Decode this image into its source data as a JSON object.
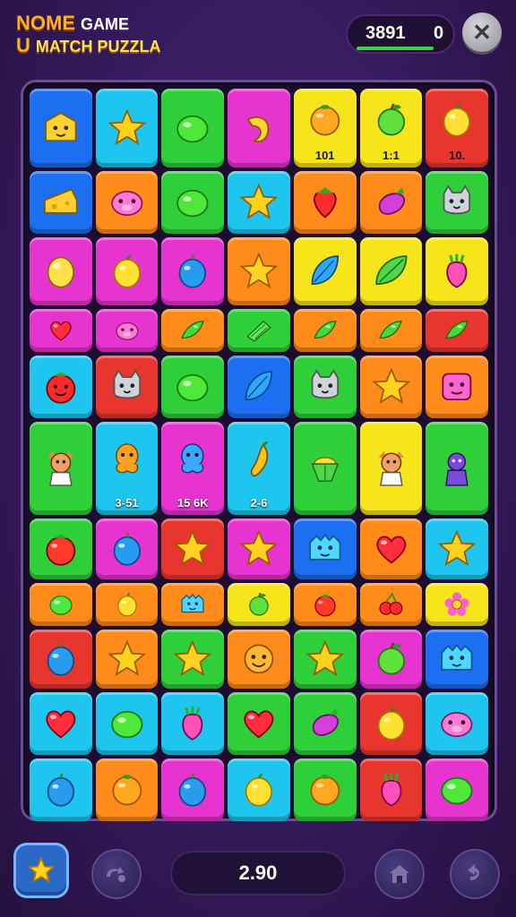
{
  "header": {
    "title_line1_a": "NOME",
    "title_line1_b": "GAME",
    "title_line2_a": "U",
    "title_line2_b": "MATCH PUZZLA",
    "score": "3891",
    "score_extra": "0",
    "close_label": "✕"
  },
  "colors": {
    "yellow": "#f7e51b",
    "cyan": "#1ec6ef",
    "green": "#2fcf3a",
    "magenta": "#e733cf",
    "red": "#e8352d",
    "orange": "#ff8b1a",
    "blue": "#1b6ff0"
  },
  "grid": {
    "columns": 7,
    "rows": [
      {
        "tiles": [
          {
            "color": "blue",
            "icon": "cheese-face",
            "label": ""
          },
          {
            "color": "cyan",
            "icon": "star",
            "label": ""
          },
          {
            "color": "green",
            "icon": "lime",
            "label": ""
          },
          {
            "color": "magenta",
            "icon": "banana",
            "label": ""
          },
          {
            "color": "yellow",
            "icon": "orange-fruit",
            "label": "101"
          },
          {
            "color": "yellow",
            "icon": "apple",
            "label": "1:1"
          },
          {
            "color": "red",
            "icon": "lemon",
            "label": "10."
          }
        ]
      },
      {
        "tiles": [
          {
            "color": "blue",
            "icon": "cheese",
            "label": ""
          },
          {
            "color": "orange",
            "icon": "pig-face",
            "label": ""
          },
          {
            "color": "green",
            "icon": "lime",
            "label": ""
          },
          {
            "color": "cyan",
            "icon": "star",
            "label": ""
          },
          {
            "color": "orange",
            "icon": "strawberry",
            "label": ""
          },
          {
            "color": "orange",
            "icon": "eggplant",
            "label": ""
          },
          {
            "color": "green",
            "icon": "cat-face",
            "label": ""
          }
        ]
      },
      {
        "tiles": [
          {
            "color": "magenta",
            "icon": "potato",
            "label": ""
          },
          {
            "color": "magenta",
            "icon": "lemon",
            "label": ""
          },
          {
            "color": "magenta",
            "icon": "plum",
            "label": ""
          },
          {
            "color": "orange",
            "icon": "star",
            "label": ""
          },
          {
            "color": "yellow",
            "icon": "blue-leaf",
            "label": ""
          },
          {
            "color": "yellow",
            "icon": "leaf",
            "label": ""
          },
          {
            "color": "yellow",
            "icon": "radish",
            "label": ""
          }
        ]
      },
      {
        "tiles": [
          {
            "color": "magenta",
            "icon": "heart",
            "label": ""
          },
          {
            "color": "magenta",
            "icon": "pig-face",
            "label": ""
          },
          {
            "color": "orange",
            "icon": "pea-pod",
            "label": ""
          },
          {
            "color": "green",
            "icon": "cucumber",
            "label": ""
          },
          {
            "color": "orange",
            "icon": "pea-pod",
            "label": ""
          },
          {
            "color": "orange",
            "icon": "pea-pod",
            "label": ""
          },
          {
            "color": "red",
            "icon": "pea-pod",
            "label": ""
          }
        ]
      },
      {
        "tiles": [
          {
            "color": "cyan",
            "icon": "tomato-face",
            "label": ""
          },
          {
            "color": "red",
            "icon": "cat-face",
            "label": ""
          },
          {
            "color": "green",
            "icon": "lime",
            "label": ""
          },
          {
            "color": "blue",
            "icon": "blue-leaf",
            "label": ""
          },
          {
            "color": "green",
            "icon": "cat-face",
            "label": ""
          },
          {
            "color": "orange",
            "icon": "star",
            "label": ""
          },
          {
            "color": "orange",
            "icon": "square-face",
            "label": ""
          }
        ]
      },
      {
        "tiles": [
          {
            "color": "green",
            "icon": "fox-character",
            "label": ""
          },
          {
            "color": "cyan",
            "icon": "orange-creature",
            "label": "3-51"
          },
          {
            "color": "magenta",
            "icon": "blue-creature",
            "label": "15 6K"
          },
          {
            "color": "cyan",
            "icon": "pepper",
            "label": "2-6"
          },
          {
            "color": "green",
            "icon": "corn-creature",
            "label": ""
          },
          {
            "color": "yellow",
            "icon": "fox-character",
            "label": ""
          },
          {
            "color": "green",
            "icon": "purple-creature",
            "label": ""
          }
        ]
      },
      {
        "tiles": [
          {
            "color": "green",
            "icon": "tomato",
            "label": ""
          },
          {
            "color": "magenta",
            "icon": "plum",
            "label": ""
          },
          {
            "color": "red",
            "icon": "star",
            "label": ""
          },
          {
            "color": "magenta",
            "icon": "star",
            "label": ""
          },
          {
            "color": "blue",
            "icon": "slime-face",
            "label": ""
          },
          {
            "color": "orange",
            "icon": "heart",
            "label": ""
          },
          {
            "color": "cyan",
            "icon": "star",
            "label": ""
          }
        ]
      },
      {
        "tiles": [
          {
            "color": "orange",
            "icon": "lime",
            "label": ""
          },
          {
            "color": "orange",
            "icon": "lemon",
            "label": ""
          },
          {
            "color": "orange",
            "icon": "slime-face",
            "label": ""
          },
          {
            "color": "yellow",
            "icon": "apple",
            "label": ""
          },
          {
            "color": "orange",
            "icon": "tomato",
            "label": ""
          },
          {
            "color": "orange",
            "icon": "cherry",
            "label": ""
          },
          {
            "color": "yellow",
            "icon": "flower",
            "label": ""
          }
        ]
      },
      {
        "tiles": [
          {
            "color": "red",
            "icon": "plum",
            "label": ""
          },
          {
            "color": "orange",
            "icon": "star",
            "label": ""
          },
          {
            "color": "green",
            "icon": "star",
            "label": ""
          },
          {
            "color": "orange",
            "icon": "smiley-face",
            "label": ""
          },
          {
            "color": "green",
            "icon": "star",
            "label": ""
          },
          {
            "color": "magenta",
            "icon": "apple",
            "label": ""
          },
          {
            "color": "blue",
            "icon": "slime-face",
            "label": ""
          }
        ]
      },
      {
        "tiles": [
          {
            "color": "cyan",
            "icon": "heart",
            "label": ""
          },
          {
            "color": "cyan",
            "icon": "lime",
            "label": ""
          },
          {
            "color": "cyan",
            "icon": "radish",
            "label": ""
          },
          {
            "color": "green",
            "icon": "heart",
            "label": ""
          },
          {
            "color": "green",
            "icon": "eggplant",
            "label": ""
          },
          {
            "color": "red",
            "icon": "lemon",
            "label": ""
          },
          {
            "color": "cyan",
            "icon": "pig-face",
            "label": ""
          }
        ]
      },
      {
        "tiles": [
          {
            "color": "cyan",
            "icon": "plum",
            "label": ""
          },
          {
            "color": "orange",
            "icon": "orange-fruit",
            "label": ""
          },
          {
            "color": "magenta",
            "icon": "plum",
            "label": ""
          },
          {
            "color": "cyan",
            "icon": "lemon",
            "label": ""
          },
          {
            "color": "green",
            "icon": "orange-fruit",
            "label": ""
          },
          {
            "color": "red",
            "icon": "radish",
            "label": ""
          },
          {
            "color": "magenta",
            "icon": "lime",
            "label": ""
          }
        ]
      }
    ]
  },
  "footer": {
    "star_button_icon": "star-icon",
    "shuffle_button_icon": "shuffle-icon",
    "moves_value": "2.90",
    "home_button_icon": "home-icon",
    "undo_button_icon": "undo-icon"
  }
}
